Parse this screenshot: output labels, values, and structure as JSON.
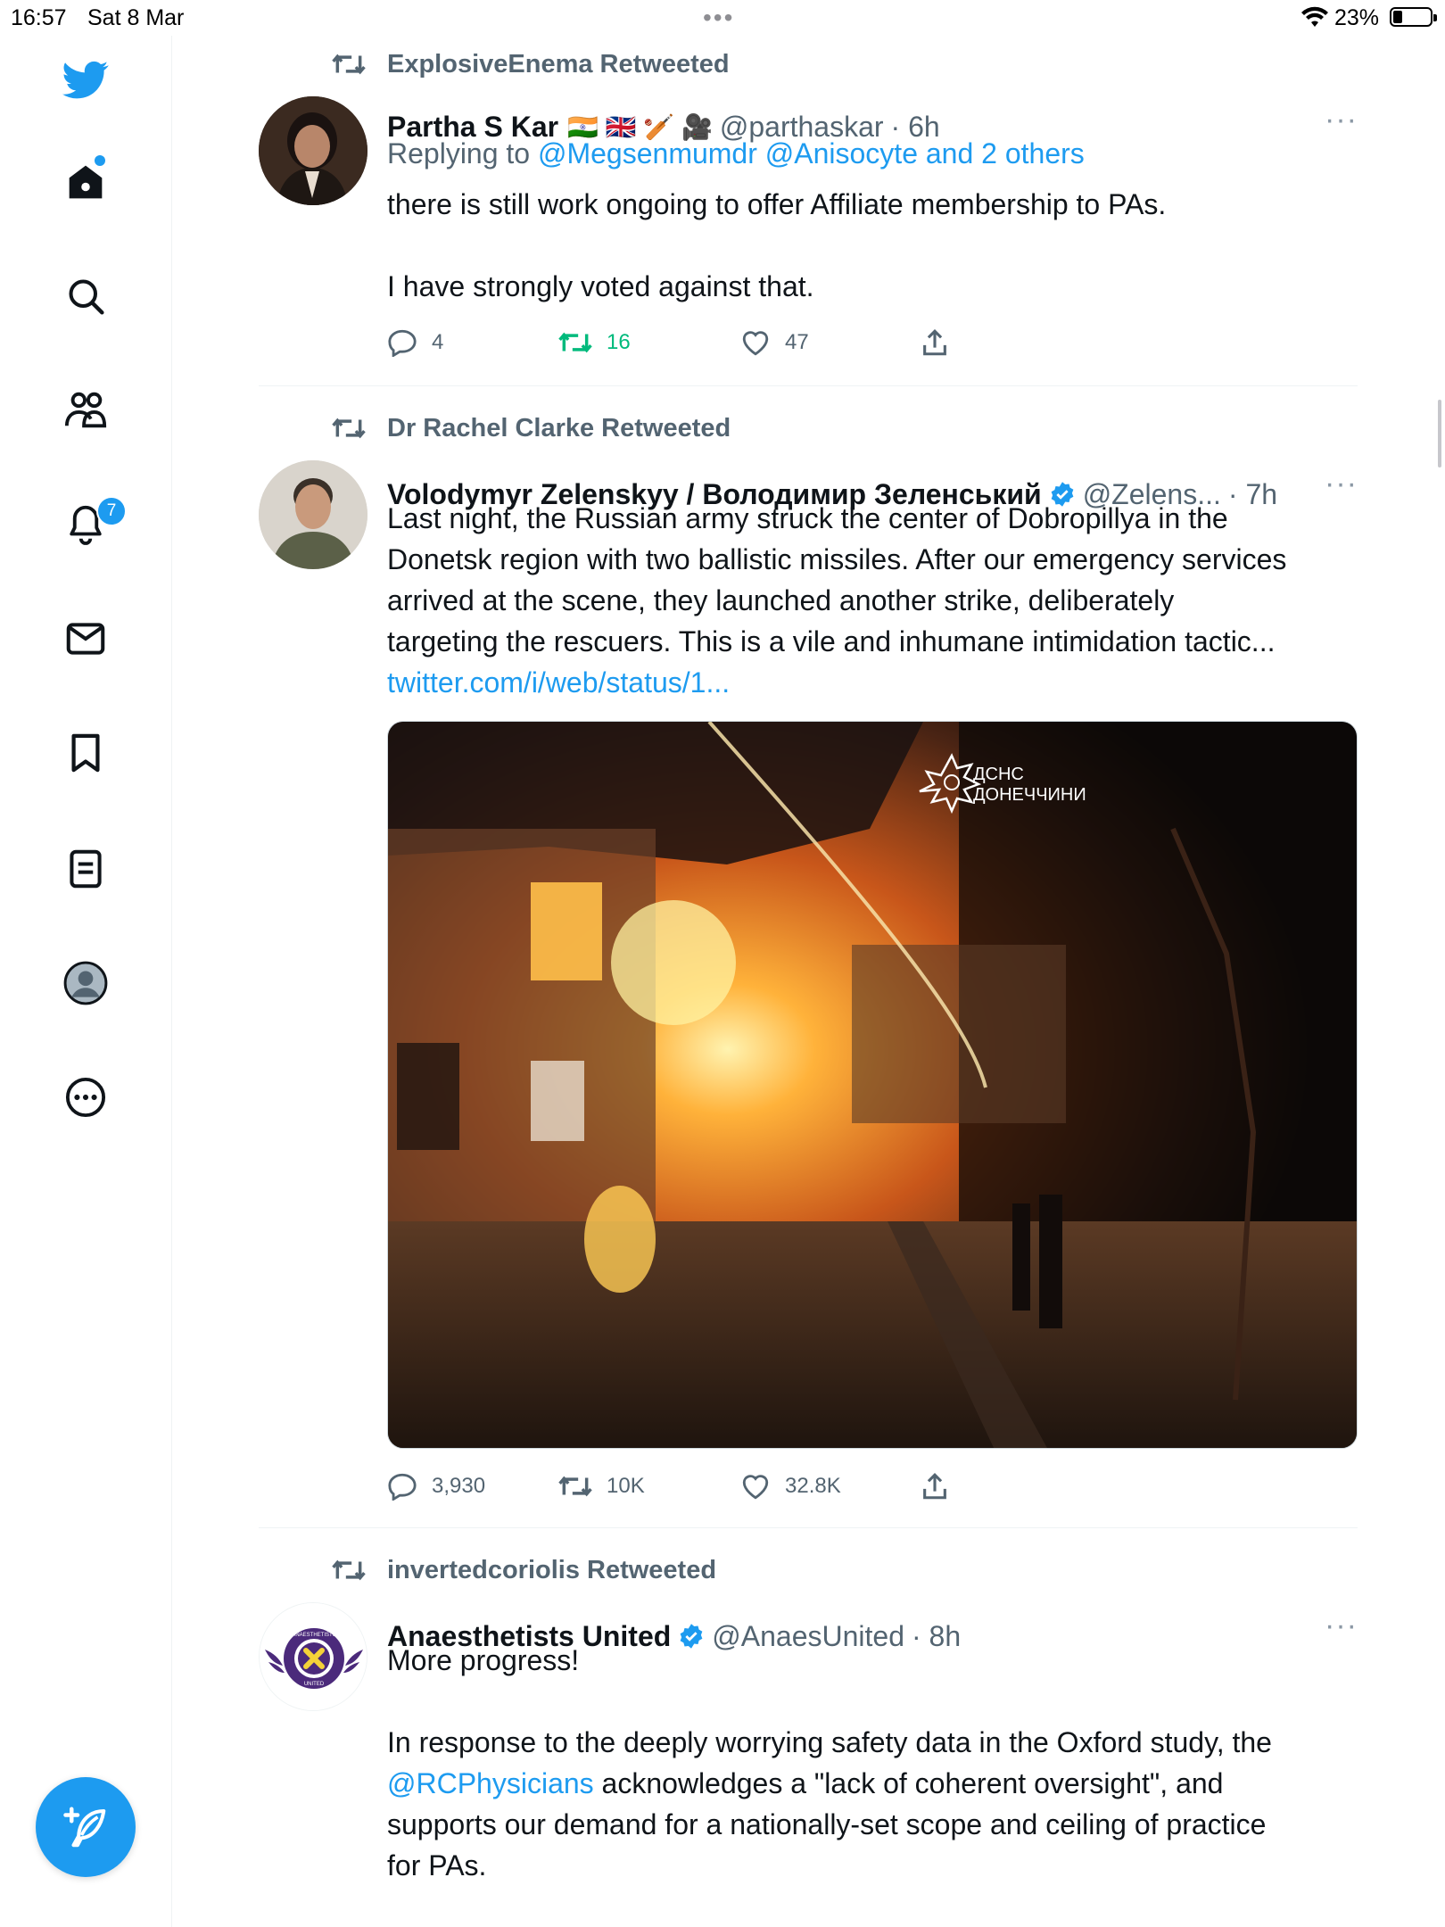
{
  "status_bar": {
    "time": "16:57",
    "date": "Sat 8 Mar",
    "battery": "23%"
  },
  "sidebar": {
    "items": [
      {
        "name": "twitter-logo"
      },
      {
        "name": "home"
      },
      {
        "name": "search"
      },
      {
        "name": "communities"
      },
      {
        "name": "notifications",
        "badge": "7"
      },
      {
        "name": "messages"
      },
      {
        "name": "bookmarks"
      },
      {
        "name": "lists"
      },
      {
        "name": "profile"
      },
      {
        "name": "more"
      }
    ]
  },
  "tweets": [
    {
      "retweeted_by": "ExplosiveEnema Retweeted",
      "name": "Partha S Kar",
      "flags": "🇮🇳 🇬🇧 🏏 🎥",
      "handle": "@parthaskar",
      "time": "· 6h",
      "reply_prefix": "Replying to ",
      "reply_to": "@Megsenmumdr @Anisocyte and 2 others",
      "text_1": "there is still work ongoing to offer Affiliate membership to PAs.",
      "text_2": "I have strongly voted against that.",
      "replies": "4",
      "retweets": "16",
      "likes": "47"
    },
    {
      "retweeted_by": "Dr Rachel Clarke Retweeted",
      "name": "Volodymyr Zelenskyy / Володимир Зеленський",
      "handle": "@Zelens...",
      "time": "· 7h",
      "text_lines": [
        "Last night, the Russian army struck the center of Dobropillya in the",
        "Donetsk region with two ballistic missiles. After our emergency services",
        "arrived at the scene, they launched another strike, deliberately",
        "targeting the rescuers. This is a vile and inhumane intimidation tactic..."
      ],
      "link": "twitter.com/i/web/status/1...",
      "image_watermark_1": "ДСНС",
      "image_watermark_2": "ДОНЕЧЧИНИ",
      "replies": "3,930",
      "retweets": "10K",
      "likes": "32.8K"
    },
    {
      "retweeted_by": "invertedcoriolis Retweeted",
      "name": "Anaesthetists United",
      "handle": "@AnaesUnited",
      "time": "· 8h",
      "text_1": "More progress!",
      "text_2_lines": [
        "In response to the deeply worrying safety data in the Oxford study, the",
        "@RCPhysicians| acknowledges a \"lack of coherent oversight\", and",
        "supports our demand for a nationally-set scope and ceiling of practice",
        "for PAs."
      ],
      "mention": "@RCPhysicians",
      "mention_rest": " acknowledges a \"lack of coherent oversight\", and",
      "logo_text_top": "ANAESTHETISTS",
      "logo_text_bottom": "UNITED"
    }
  ],
  "colors": {
    "accent": "#1d9bf0",
    "retweet_green": "#00ba7c",
    "muted": "#536471"
  }
}
